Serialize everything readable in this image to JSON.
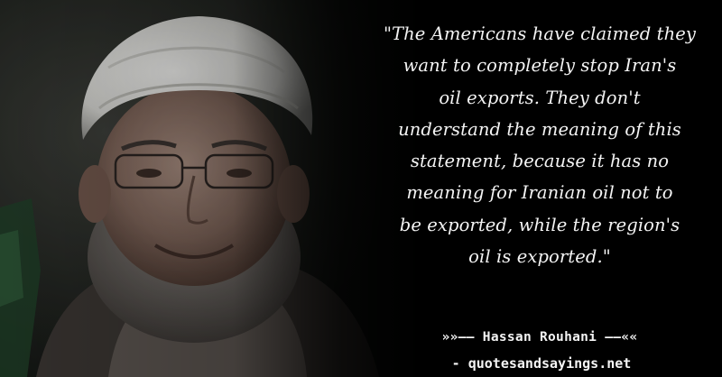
{
  "quote": {
    "text": "\"The Americans have claimed they\nwant to completely stop Iran's\noil exports. They don't\nunderstand the meaning of this\nstatement, because it has no\nmeaning for Iranian oil not to\nbe exported, while the region's\noil is exported.\""
  },
  "author": {
    "line": "»»–– Hassan Rouhani ––««"
  },
  "source": {
    "text": "- quotesandsayings.net"
  },
  "colors": {
    "background": "#000000",
    "text": "#f4f4f4"
  }
}
